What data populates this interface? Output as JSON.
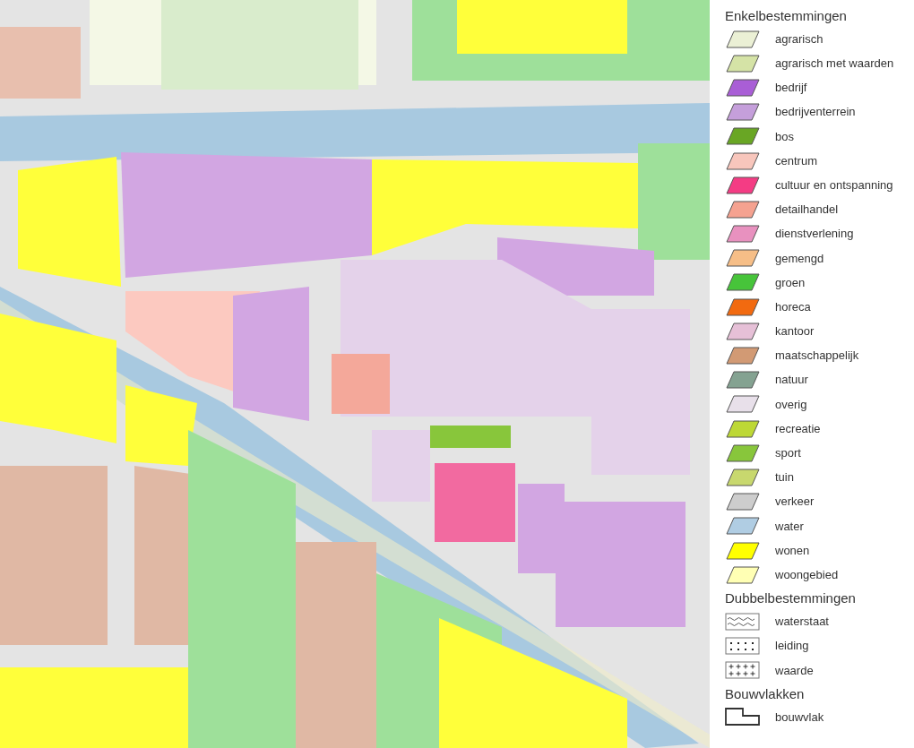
{
  "legend": {
    "sections": [
      {
        "title": "Enkelbestemmingen",
        "items": [
          {
            "kind": "swatch",
            "label": "agrarisch",
            "color": "#ebf0d5"
          },
          {
            "kind": "swatch",
            "label": "agrarisch met waarden",
            "color": "#d5e3a6"
          },
          {
            "kind": "swatch",
            "label": "bedrijf",
            "color": "#a95ed6"
          },
          {
            "kind": "swatch",
            "label": "bedrijventerrein",
            "color": "#c59fdb"
          },
          {
            "kind": "swatch",
            "label": "bos",
            "color": "#69a624"
          },
          {
            "kind": "swatch",
            "label": "centrum",
            "color": "#f8c6bc"
          },
          {
            "kind": "swatch",
            "label": "cultuur en ontspanning",
            "color": "#f43c84"
          },
          {
            "kind": "swatch",
            "label": "detailhandel",
            "color": "#f5a290"
          },
          {
            "kind": "swatch",
            "label": "dienstverlening",
            "color": "#e891bf"
          },
          {
            "kind": "swatch",
            "label": "gemengd",
            "color": "#f6be87"
          },
          {
            "kind": "swatch",
            "label": "groen",
            "color": "#47c43a"
          },
          {
            "kind": "swatch",
            "label": "horeca",
            "color": "#f26a10"
          },
          {
            "kind": "swatch",
            "label": "kantoor",
            "color": "#e6c0d7"
          },
          {
            "kind": "swatch",
            "label": "maatschappelijk",
            "color": "#d29a74"
          },
          {
            "kind": "swatch",
            "label": "natuur",
            "color": "#84a291"
          },
          {
            "kind": "swatch",
            "label": "overig",
            "color": "#e8e0ea"
          },
          {
            "kind": "swatch",
            "label": "recreatie",
            "color": "#bdd835"
          },
          {
            "kind": "swatch",
            "label": "sport",
            "color": "#88c63b"
          },
          {
            "kind": "swatch",
            "label": "tuin",
            "color": "#c8d86e"
          },
          {
            "kind": "swatch",
            "label": "verkeer",
            "color": "#cdcdcd"
          },
          {
            "kind": "swatch",
            "label": "water",
            "color": "#b0cde3"
          },
          {
            "kind": "swatch",
            "label": "wonen",
            "color": "#ffff00"
          },
          {
            "kind": "swatch",
            "label": "woongebied",
            "color": "#ffffb4"
          }
        ]
      },
      {
        "title": "Dubbelbestemmingen",
        "items": [
          {
            "kind": "waves",
            "label": "waterstaat"
          },
          {
            "kind": "dots",
            "label": "leiding"
          },
          {
            "kind": "crosses",
            "label": "waarde"
          }
        ]
      },
      {
        "title": "Bouwvlakken",
        "items": [
          {
            "kind": "outline",
            "label": "bouwvlak"
          }
        ]
      }
    ]
  }
}
